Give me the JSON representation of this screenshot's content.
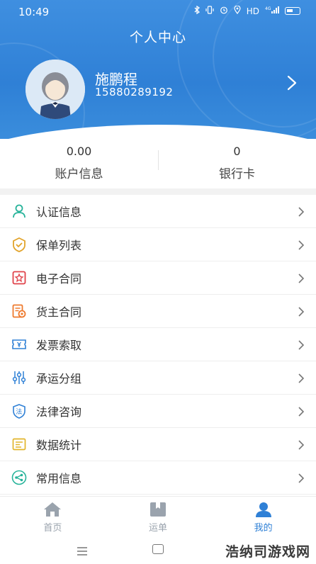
{
  "status_bar": {
    "time": "10:49",
    "network": "HD",
    "signal": "4G"
  },
  "header": {
    "title": "个人中心"
  },
  "profile": {
    "name": "施鹏程",
    "phone": "15880289192"
  },
  "stats": [
    {
      "value": "0.00",
      "label": "账户信息"
    },
    {
      "value": "0",
      "label": "银行卡"
    }
  ],
  "menu": [
    {
      "label": "认证信息",
      "icon": "person-icon",
      "color": "#27b39a"
    },
    {
      "label": "保单列表",
      "icon": "shield-check-icon",
      "color": "#e2a42b"
    },
    {
      "label": "电子合同",
      "icon": "contract-seal-icon",
      "color": "#e0424a"
    },
    {
      "label": "货主合同",
      "icon": "cargo-contract-icon",
      "color": "#ee7a2e"
    },
    {
      "label": "发票索取",
      "icon": "invoice-icon",
      "color": "#2f80d6"
    },
    {
      "label": "承运分组",
      "icon": "sliders-icon",
      "color": "#2f80d6"
    },
    {
      "label": "法律咨询",
      "icon": "law-shield-icon",
      "color": "#2f80d6"
    },
    {
      "label": "数据统计",
      "icon": "data-stats-icon",
      "color": "#e2b52b"
    },
    {
      "label": "常用信息",
      "icon": "share-icon",
      "color": "#27b39a"
    }
  ],
  "tabs": [
    {
      "label": "首页",
      "icon": "home-icon"
    },
    {
      "label": "运单",
      "icon": "waybill-icon"
    },
    {
      "label": "我的",
      "icon": "profile-icon",
      "active": true
    }
  ],
  "colors": {
    "primary": "#2f80d6",
    "inactive": "#9aa3ad"
  },
  "watermark": "浩纳司游戏网"
}
